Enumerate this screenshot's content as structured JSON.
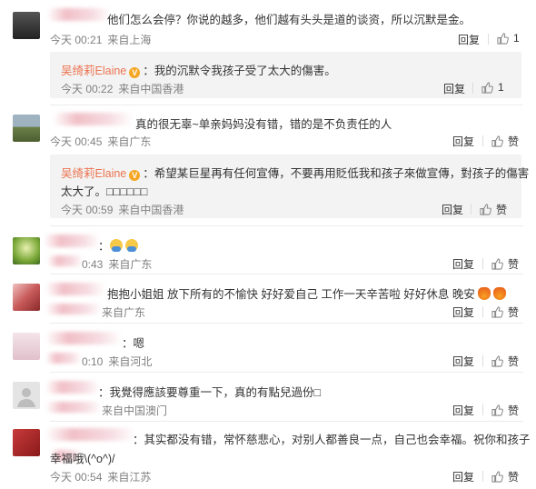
{
  "comments": [
    {
      "text": "他们怎么会停？你说的越多，他们越有头头是道的谈资，所以沉默是金。",
      "time": "今天 00:21",
      "source": "来自上海",
      "reply_label": "回复",
      "likes": "1",
      "avatar_color": "#3a3a3a",
      "sub": {
        "name": "吴绮莉Elaine",
        "text": "：我的沉默令我孩子受了太大的傷害。",
        "time": "今天 00:22",
        "source": "来自中国香港",
        "reply_label": "回复",
        "likes": "1"
      }
    },
    {
      "text": "真的很无辜~单亲妈妈没有错，错的是不负责任的人",
      "time": "今天 00:45",
      "source": "来自广东",
      "reply_label": "回复",
      "likes": "赞",
      "avatar_color": "#6b7f4a",
      "sub": {
        "name": "吴绮莉Elaine",
        "text": "：希望某巨星再有任何宣傳，不要再用貶低我和孩子來做宣傳，對孩子的傷害",
        "text2": "太大了。□□□□□□",
        "time": "今天 00:59",
        "source": "来自中国香港",
        "reply_label": "回复",
        "likes": "赞"
      }
    },
    {
      "text": "：",
      "time": "0:43",
      "source": "来自广东",
      "reply_label": "回复",
      "likes": "赞",
      "avatar_color": "#8fbf5a"
    },
    {
      "text": "抱抱小姐姐 放下所有的不愉快 好好爱自己 工作一天辛苦啦 好好休息 晚安",
      "time": "",
      "source": "来自广东",
      "reply_label": "回复",
      "likes": "赞",
      "avatar_color": "#c85a5a"
    },
    {
      "text": "：嗯",
      "time": "0:10",
      "source": "来自河北",
      "reply_label": "回复",
      "likes": "赞",
      "avatar_color": "#e8d0d8"
    },
    {
      "text": "：我覺得應該要尊重一下，真的有點兒過份□",
      "time": "",
      "source": "来自中国澳门",
      "reply_label": "回复",
      "likes": "赞",
      "avatar_color": "#d8d8d8"
    },
    {
      "text": "：其实都没有错，常怀慈悲心，对别人都善良一点，自己也会幸福。祝你和孩子",
      "text2": "幸福哦\\(^o^)/",
      "time": "今天 00:54",
      "source": "来自江苏",
      "reply_label": "回复",
      "likes": "赞",
      "avatar_color": "#a02020"
    }
  ],
  "colors": {
    "name": "#eb7350",
    "meta": "#808080",
    "text": "#333333",
    "sub_bg": "#f3f3f3"
  }
}
